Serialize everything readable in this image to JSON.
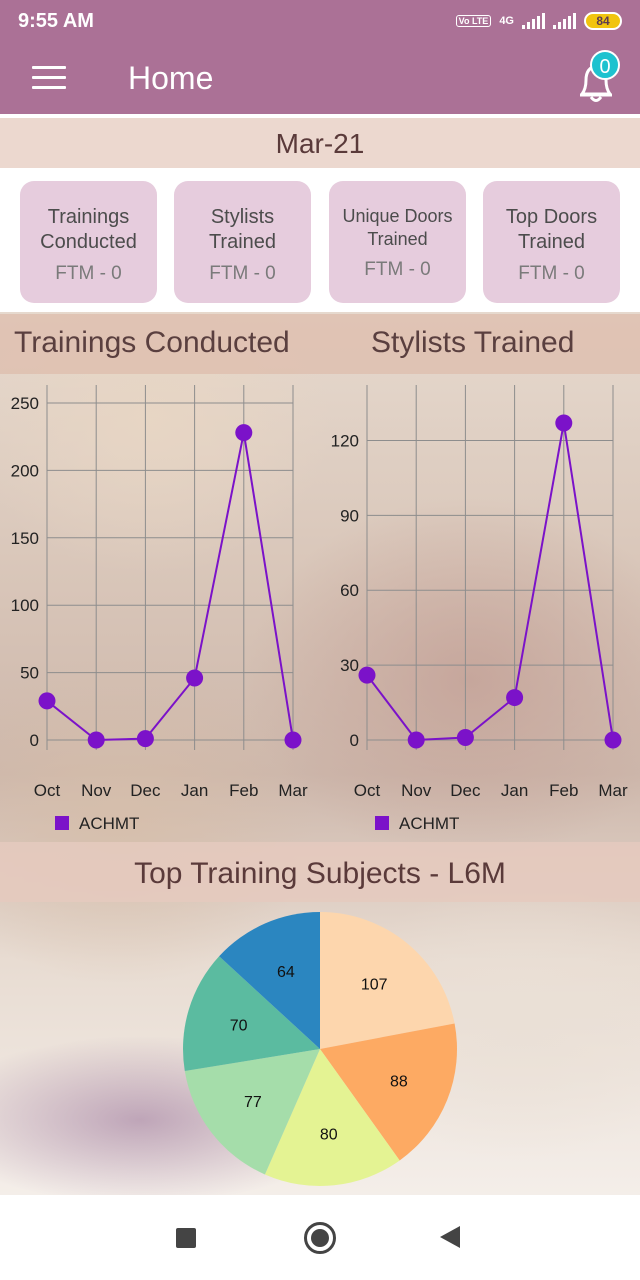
{
  "status_bar": {
    "time": "9:55 AM",
    "network": "4G",
    "volte": "Vo LTE",
    "battery": "84"
  },
  "app_bar": {
    "title": "Home",
    "notification_count": "0"
  },
  "period": "Mar-21",
  "cards": [
    {
      "title_line1": "Trainings",
      "title_line2": "Conducted",
      "sub": "FTM - 0"
    },
    {
      "title_line1": "Stylists",
      "title_line2": "Trained",
      "sub": "FTM - 0"
    },
    {
      "title_line1": "Unique Doors",
      "title_line2": "Trained",
      "sub": "FTM - 0"
    },
    {
      "title_line1": "Top Doors",
      "title_line2": "Trained",
      "sub": "FTM - 0"
    }
  ],
  "chart_titles": {
    "left": "Trainings Conducted",
    "right": "Stylists Trained",
    "pie": "Top Training Subjects - L6M"
  },
  "colors": {
    "bar": "#ab7196",
    "line": "#7b12c9",
    "badge": "#1ec2cf"
  },
  "chart_data": [
    {
      "type": "line",
      "title": "Trainings Conducted",
      "categories": [
        "Oct",
        "Nov",
        "Dec",
        "Jan",
        "Feb",
        "Mar"
      ],
      "series": [
        {
          "name": "ACHMT",
          "values": [
            29,
            0,
            1,
            46,
            228,
            0
          ]
        }
      ],
      "ylim": [
        0,
        250
      ],
      "yticks": [
        0,
        50,
        100,
        150,
        200,
        250
      ],
      "grid": true,
      "legend": "bottom-left"
    },
    {
      "type": "line",
      "title": "Stylists Trained",
      "categories": [
        "Oct",
        "Nov",
        "Dec",
        "Jan",
        "Feb",
        "Mar"
      ],
      "series": [
        {
          "name": "ACHMT",
          "values": [
            26,
            0,
            1,
            17,
            127,
            0
          ]
        }
      ],
      "ylim": [
        0,
        135
      ],
      "yticks": [
        0,
        30,
        60,
        90,
        120
      ],
      "grid": true,
      "legend": "bottom-left"
    },
    {
      "type": "pie",
      "title": "Top Training Subjects - L6M",
      "values": [
        107,
        88,
        80,
        77,
        70,
        64
      ],
      "colors": [
        "#fdd6ad",
        "#fdaa63",
        "#e4f393",
        "#a5ddaa",
        "#5bbba0",
        "#2b86c0"
      ]
    }
  ]
}
